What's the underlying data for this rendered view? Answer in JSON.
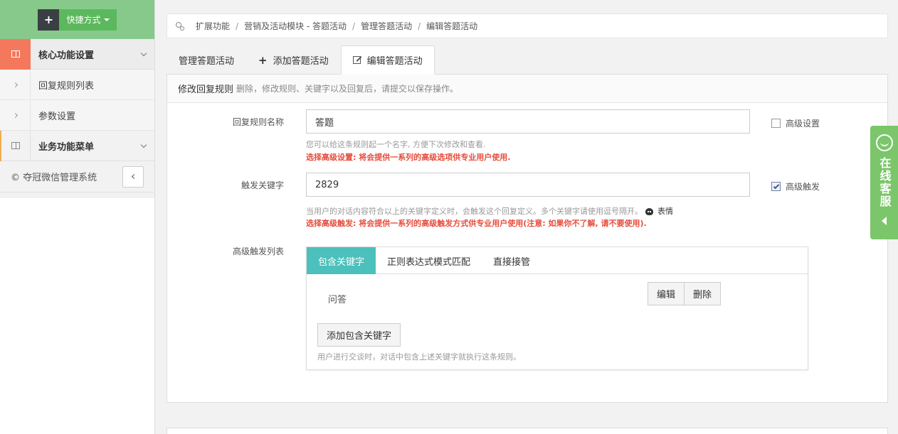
{
  "sidebar": {
    "shortcut_label": "快捷方式",
    "groups": [
      {
        "label": "核心功能设置",
        "items": [
          "回复规则列表",
          "参数设置"
        ]
      },
      {
        "label": "业务功能菜单"
      }
    ],
    "copyright": "© 夺冠微信管理系统"
  },
  "breadcrumb": [
    "扩展功能",
    "营销及活动模块 - 答题活动",
    "管理答题活动",
    "编辑答题活动"
  ],
  "tabs": [
    "管理答题活动",
    "添加答题活动",
    "编辑答题活动"
  ],
  "panel": {
    "title": "修改回复规则",
    "subtitle": "删除，修改规则、关键字以及回复后，请提交以保存操作。"
  },
  "form": {
    "name_label": "回复规则名称",
    "name_value": "答题",
    "name_help": "您可以给这条规则起一个名字, 方便下次修改和查看.",
    "name_help_red": "选择高级设置: 将会提供一系列的高级选项供专业用户使用.",
    "advanced_setting_label": "高级设置",
    "advanced_setting_checked": false,
    "keyword_label": "触发关键字",
    "keyword_value": "2829",
    "keyword_help": "当用户的对话内容符合以上的关键字定义时，会触发这个回复定义。多个关键字请使用逗号隔开。",
    "emoji_label": "表情",
    "keyword_help_red": "选择高级触发: 将会提供一系列的高级触发方式供专业用户使用(注意: 如果你不了解, 请不要使用).",
    "advanced_trigger_label": "高级触发",
    "advanced_trigger_checked": true,
    "trigger_list_label": "高级触发列表"
  },
  "trigger_panel": {
    "tabs": [
      "包含关键字",
      "正则表达式模式匹配",
      "直接接管"
    ],
    "keyword": "问答",
    "edit_label": "编辑",
    "delete_label": "删除",
    "add_label": "添加包含关键字",
    "help": "用户进行交谈时，对话中包含上述关键字就执行这条规则。"
  },
  "service": {
    "text": "在线客服"
  },
  "colors": {
    "accent_green": "#87c98b",
    "active_orange": "#f4785c",
    "teal": "#4bc0bc",
    "red": "#e74c3c",
    "service_green": "#7bc66b"
  }
}
